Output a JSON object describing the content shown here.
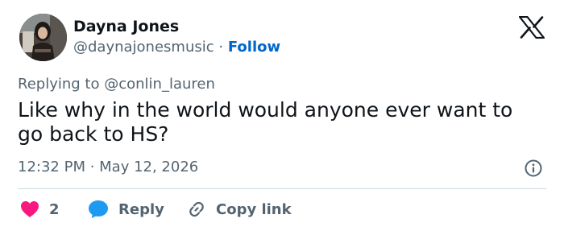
{
  "author": {
    "name": "Dayna Jones",
    "handle": "@daynajonesmusic",
    "separator": "·",
    "follow_label": "Follow"
  },
  "tweet": {
    "replying_prefix": "Replying to",
    "replying_to": "@conlin_lauren",
    "text": "Like why in the world would anyone ever want to go back to HS?",
    "timestamp": "12:32 PM · May 12, 2026"
  },
  "actions": {
    "like_count": "2",
    "reply_label": "Reply",
    "copy_label": "Copy link"
  },
  "icons": {
    "logo": "x-logo-icon",
    "info": "info-icon",
    "like": "heart-icon",
    "reply": "speech-bubble-icon",
    "copy": "link-icon"
  },
  "colors": {
    "accent": "#0066cc",
    "like": "#f91880",
    "reply": "#1d9bf0",
    "secondary_text": "#536471",
    "primary_text": "#0f1419",
    "divider": "#cfd9de"
  }
}
